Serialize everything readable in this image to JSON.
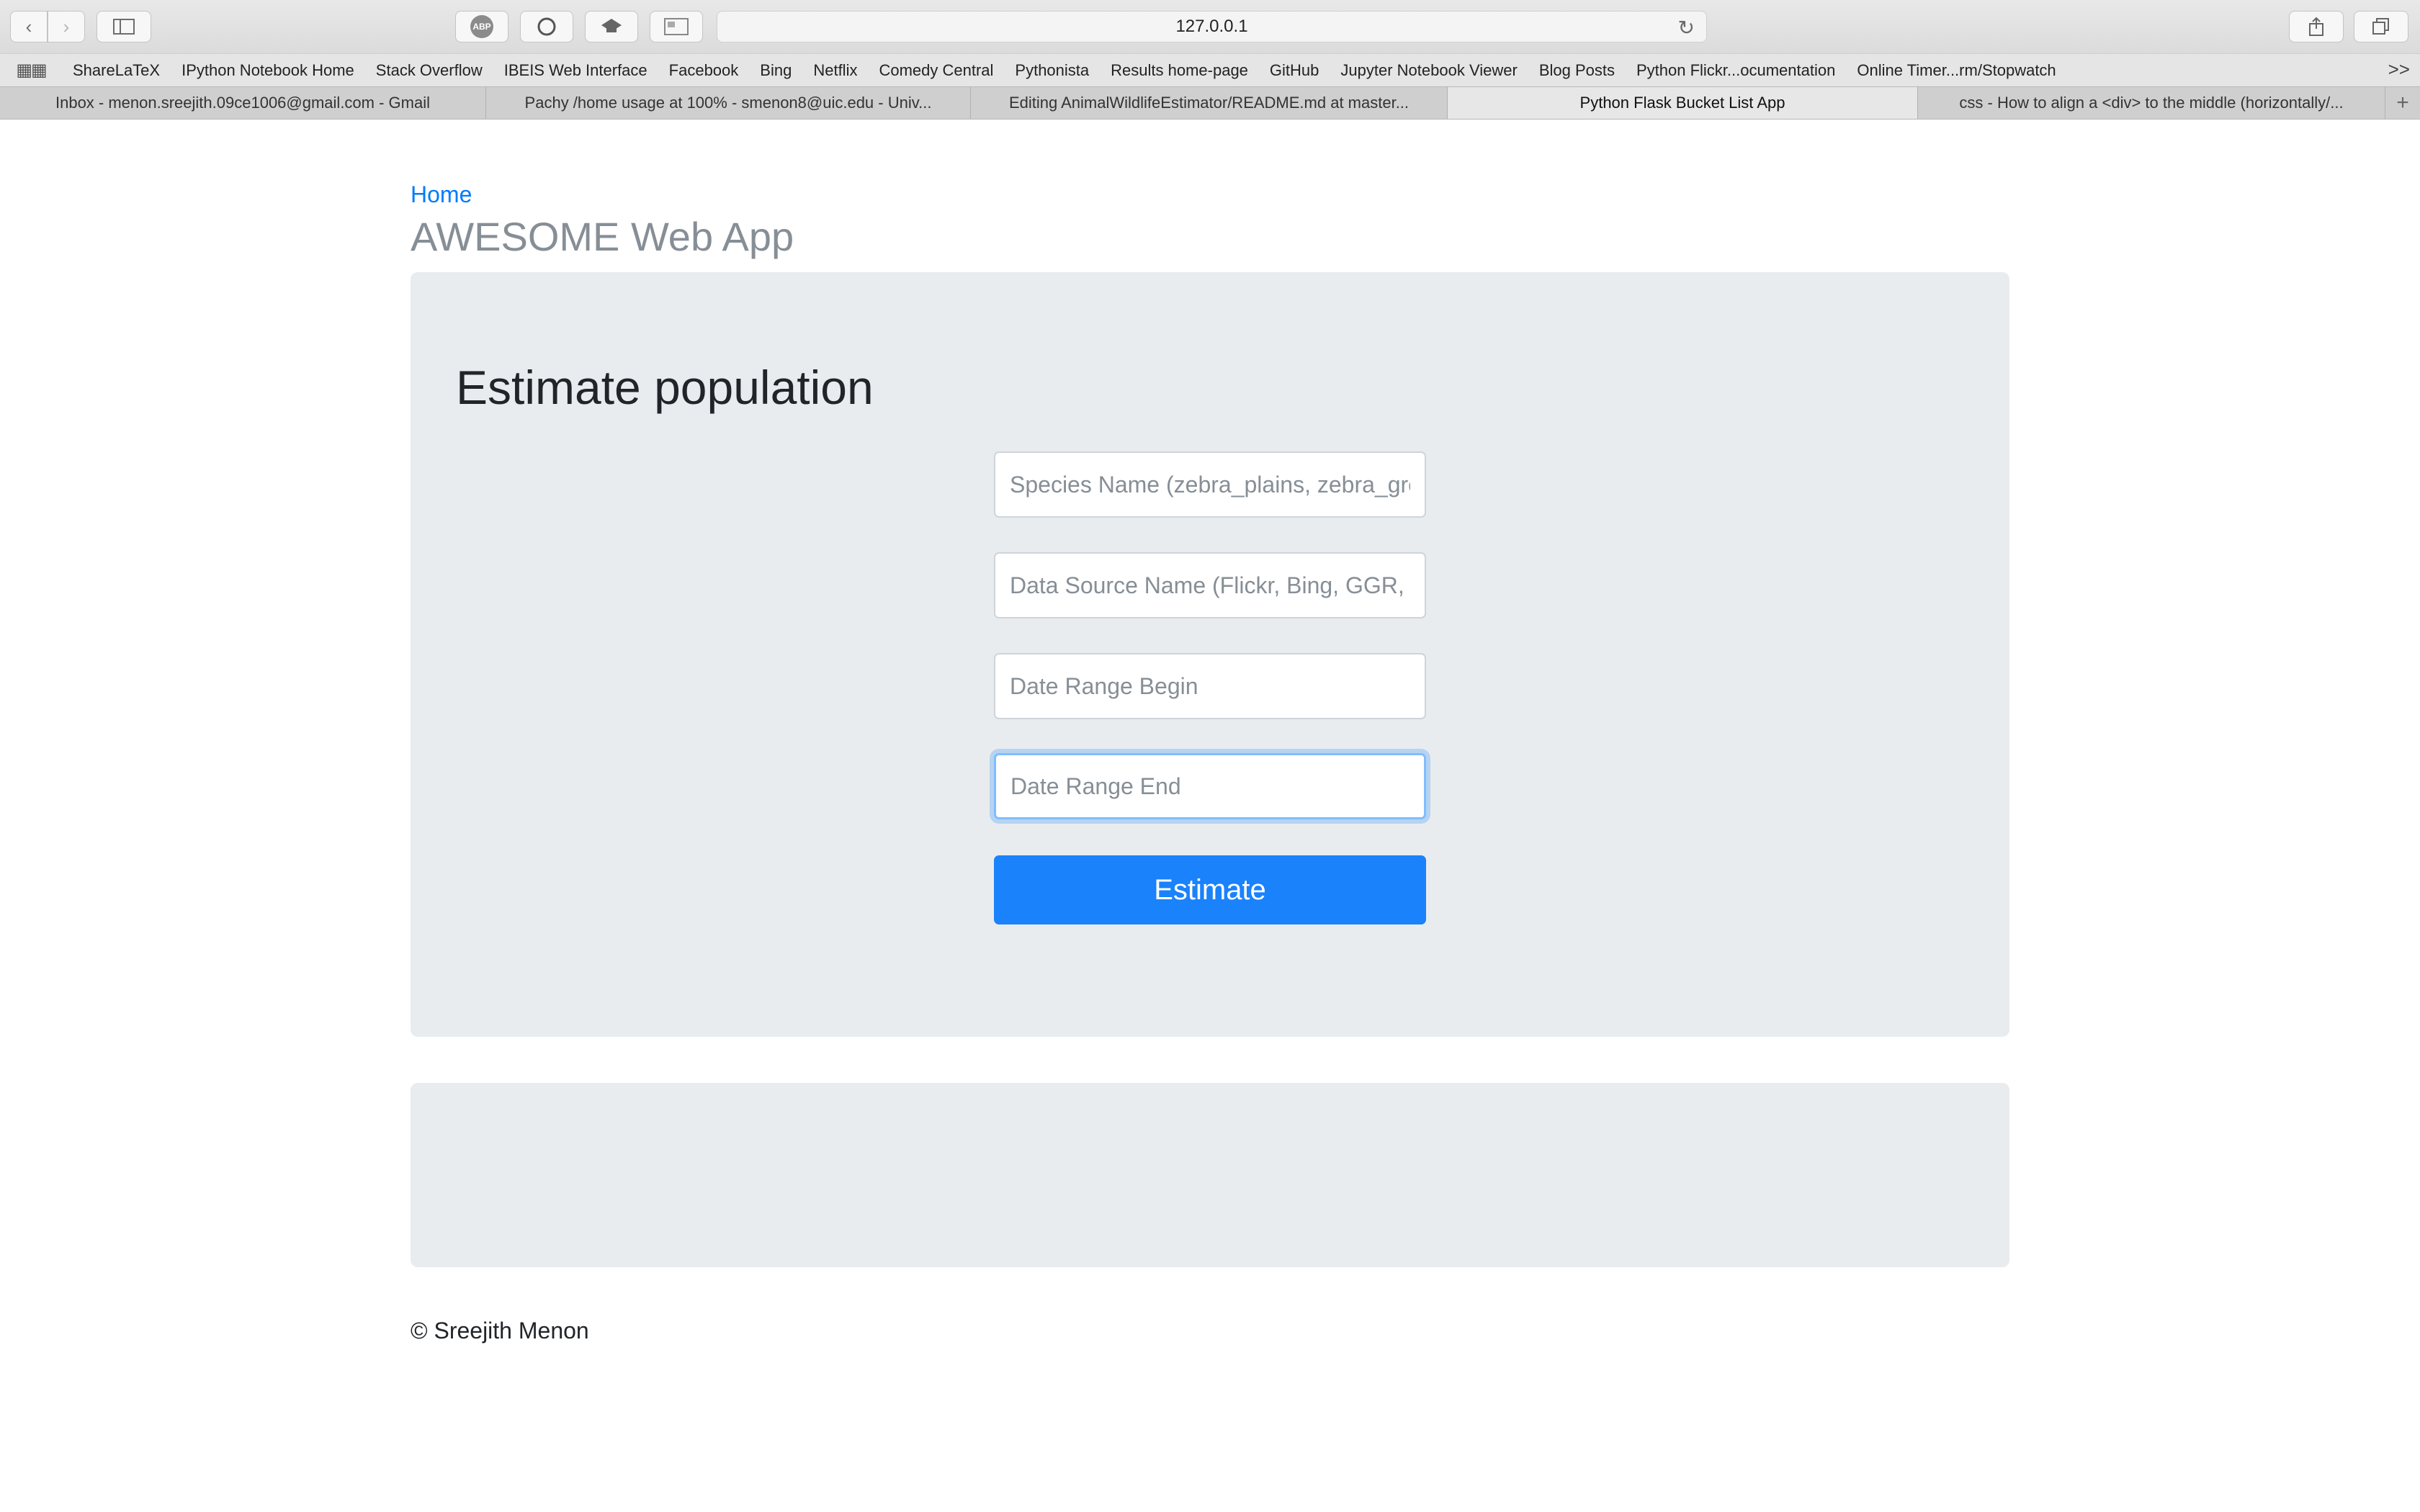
{
  "browser": {
    "url": "127.0.0.1",
    "toolbar_icons": [
      "back-icon",
      "forward-icon",
      "sidebar-icon",
      "adblock-icon",
      "circle-extension-icon",
      "cap-extension-icon",
      "screen-extension-icon",
      "reload-icon",
      "share-icon",
      "tabs-overview-icon"
    ],
    "adblock_label": "ABP",
    "bookmarks": [
      "ShareLaTeX",
      "IPython Notebook Home",
      "Stack Overflow",
      "IBEIS Web Interface",
      "Facebook",
      "Bing",
      "Netflix",
      "Comedy Central",
      "Pythonista",
      "Results home-page",
      "GitHub",
      "Jupyter Notebook Viewer",
      "Blog Posts",
      "Python Flickr...ocumentation",
      "Online Timer...rm/Stopwatch"
    ],
    "bookmarks_more": ">>",
    "tabs": [
      {
        "label": "Inbox - menon.sreejith.09ce1006@gmail.com - Gmail",
        "active": false
      },
      {
        "label": "Pachy /home usage at 100% - smenon8@uic.edu - Univ...",
        "active": false
      },
      {
        "label": "Editing AnimalWildlifeEstimator/README.md at master...",
        "active": false
      },
      {
        "label": "Python Flask Bucket List App",
        "active": true
      },
      {
        "label": "css - How to align a <div> to the middle (horizontally/...",
        "active": false
      }
    ],
    "new_tab": "+"
  },
  "page": {
    "home_link": "Home",
    "site_title": "AWESOME Web App",
    "form": {
      "heading": "Estimate population",
      "species_placeholder": "Species Name (zebra_plains, zebra_grevys)",
      "source_placeholder": "Data Source Name (Flickr, Bing, GGR, Google)",
      "begin_placeholder": "Date Range Begin",
      "end_placeholder": "Date Range End",
      "submit_label": "Estimate"
    },
    "footer": "© Sreejith Menon"
  },
  "colors": {
    "link": "#007bff",
    "button": "#1a82fb",
    "jumbotron": "#e9ecef",
    "focus_ring": "#80bdff"
  }
}
